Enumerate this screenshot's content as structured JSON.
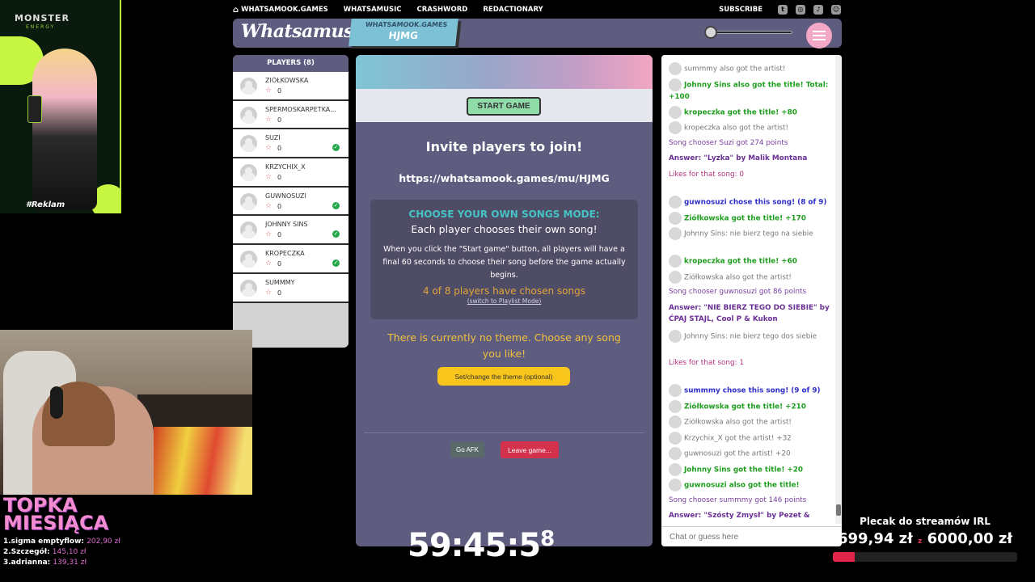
{
  "topnav": {
    "items": [
      "WHATSAMOOK.GAMES",
      "WHATSAMUSIC",
      "CRASHWORD",
      "REDACTIONARY"
    ],
    "subscribe": "SUBSCRIBE",
    "social_icons": [
      "twitter-icon",
      "instagram-icon",
      "tiktok-icon",
      "discord-icon"
    ]
  },
  "header": {
    "logo": "Whatsamusic",
    "code_site": "WHATSAMOOK.GAMES",
    "room_code": "HJMG",
    "volume": 0.03
  },
  "players": {
    "title": "PLAYERS (8)",
    "list": [
      {
        "name": "ZIÓŁKOWSKA",
        "score": "0",
        "chosen": false
      },
      {
        "name": "SPERMOSKARPETKA...",
        "score": "0",
        "chosen": false
      },
      {
        "name": "SUZI",
        "score": "0",
        "chosen": true
      },
      {
        "name": "KRZYCHIX_X",
        "score": "0",
        "chosen": false
      },
      {
        "name": "GUWNOSUZI",
        "score": "0",
        "chosen": true
      },
      {
        "name": "JOHNNY SINS",
        "score": "0",
        "chosen": true
      },
      {
        "name": "KROPECZKA",
        "score": "0",
        "chosen": true
      },
      {
        "name": "SUMMMY",
        "score": "0",
        "chosen": false
      }
    ]
  },
  "main": {
    "start_button": "START GAME",
    "invite_title": "Invite players to join!",
    "invite_url": "https://whatsamook.games/mu/HJMG",
    "mode_title": "CHOOSE YOUR OWN SONGS MODE:",
    "mode_subtitle": "Each player chooses their own song!",
    "mode_desc": "When you click the \"Start game\" button, all players will have a final 60 seconds to choose their song before the game actually begins.",
    "chosen_status": "4 of 8 players have chosen songs",
    "switch_link": "(switch to Playlist Mode)",
    "theme_text": "There is currently no theme. Choose any song you like!",
    "theme_button": "Set/change the theme (optional)",
    "afk_button": "Go AFK",
    "leave_button": "Leave game..."
  },
  "chat": {
    "messages": [
      {
        "text": "summmy also got the artist!",
        "style": "gray",
        "avatar": true
      },
      {
        "text": "Johnny Sins also got the title! Total: +100",
        "style": "green",
        "avatar": true
      },
      {
        "text": "kropeczka got the title! +80",
        "style": "green",
        "avatar": true
      },
      {
        "text": "kropeczka also got the artist!",
        "style": "gray",
        "avatar": true
      },
      {
        "text": "Song chooser Suzi got 274 points",
        "style": "purple",
        "avatar": false
      },
      {
        "text": "Answer: \"Lyzka\" by Malik Montana",
        "style": "purpleb",
        "avatar": false
      },
      {
        "text": "Likes for that song: 0",
        "style": "pink",
        "avatar": false
      },
      {
        "text": "guwnosuzi chose this song! (8 of 9)",
        "style": "blueb",
        "avatar": true
      },
      {
        "text": "Ziółkowska got the title! +170",
        "style": "green",
        "avatar": true
      },
      {
        "text": "Johnny Sins: nie bierz tego na siebie",
        "style": "gray",
        "avatar": true
      },
      {
        "text": "kropeczka got the title! +60",
        "style": "green",
        "avatar": true
      },
      {
        "text": "Ziółkowska also got the artist!",
        "style": "gray",
        "avatar": true
      },
      {
        "text": "Song chooser guwnosuzi got 86 points",
        "style": "purple",
        "avatar": false
      },
      {
        "text": "Answer: \"NIE BIERZ TEGO DO SIEBIE\" by ĆPAJ STAJL, Cool P & Kukon",
        "style": "purpleb",
        "avatar": false
      },
      {
        "text": "Johnny Sins: nie bierz tego dos siebie",
        "style": "gray",
        "avatar": true
      },
      {
        "text": "Likes for that song: 1",
        "style": "pink",
        "avatar": false
      },
      {
        "text": "summmy chose this song! (9 of 9)",
        "style": "blueb",
        "avatar": true
      },
      {
        "text": "Ziółkowska got the title! +210",
        "style": "green",
        "avatar": true
      },
      {
        "text": "Ziółkowska also got the artist!",
        "style": "gray",
        "avatar": true
      },
      {
        "text": "Krzychix_X got the artist! +32",
        "style": "gray",
        "avatar": true
      },
      {
        "text": "guwnosuzi got the artist! +20",
        "style": "gray",
        "avatar": true
      },
      {
        "text": "Johnny Sins got the title! +20",
        "style": "green",
        "avatar": true
      },
      {
        "text": "guwnosuzi also got the title!",
        "style": "green",
        "avatar": true
      },
      {
        "text": "Song chooser summmy got 146 points",
        "style": "purple",
        "avatar": false
      },
      {
        "text": "Answer: \"Szósty Zmysł\" by Pezet & NOON",
        "style": "purpleb",
        "avatar": false
      },
      {
        "text": "Likes for that song: 0",
        "style": "pink",
        "avatar": false
      }
    ],
    "input_placeholder": "Chat or guess here"
  },
  "overlay": {
    "ad_brand": "MONSTER",
    "ad_brand_sub": "ENERGY",
    "ad_hashtag": "#Reklam",
    "topka_line1": "TOPKA",
    "topka_line2": "MIESIĄCA",
    "ranks": [
      {
        "label": "1.sigma emptyflow:",
        "amount": "202,90 zł"
      },
      {
        "label": "2.Szczegół:",
        "amount": "145,10 zł"
      },
      {
        "label": "3.adrianna:",
        "amount": "139,31 zł"
      }
    ],
    "timer_main": "59:45:5",
    "timer_frac": "8",
    "goal_title": "Plecak do streamów IRL",
    "goal_current": "699,94 zł",
    "goal_sep": "z",
    "goal_target": "6000,00 zł",
    "goal_fraction": 0.117
  },
  "colors": {
    "panel": "#5e5d80",
    "accent_green": "#8fdca9",
    "accent_yellow": "#f8c51c",
    "accent_red": "#d4314c",
    "menu_pink": "#f2a8c6"
  }
}
